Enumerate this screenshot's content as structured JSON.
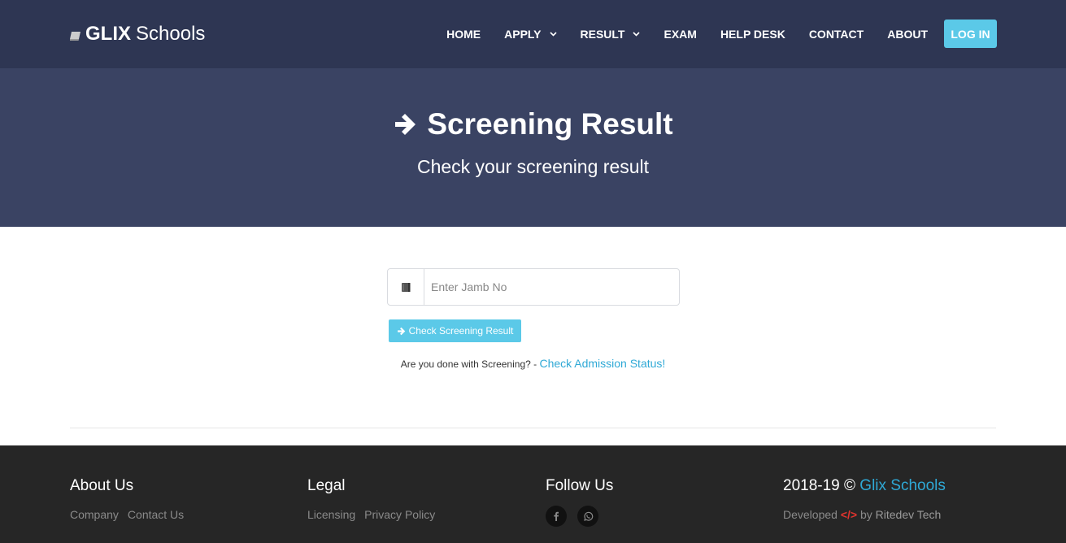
{
  "brand": {
    "bold": "GLIX",
    "light": "Schools",
    "icon": "book-icon"
  },
  "nav": {
    "items": [
      {
        "label": "HOME",
        "dropdown": false
      },
      {
        "label": "APPLY",
        "dropdown": true
      },
      {
        "label": "RESULT",
        "dropdown": true
      },
      {
        "label": "EXAM",
        "dropdown": false
      },
      {
        "label": "HELP DESK",
        "dropdown": false
      },
      {
        "label": "CONTACT",
        "dropdown": false
      },
      {
        "label": "ABOUT",
        "dropdown": false
      }
    ],
    "login_label": "LOG IN"
  },
  "hero": {
    "title": "Screening Result",
    "subtitle": "Check your screening result",
    "icon": "arrow-right-icon"
  },
  "form": {
    "placeholder": "Enter Jamb No",
    "value": "",
    "button_label": "Check Screening Result",
    "done_text": "Are you done with Screening? - ",
    "done_link": "Check Admission Status!"
  },
  "footer": {
    "about": {
      "title": "About Us",
      "links": [
        "Company",
        "Contact Us"
      ]
    },
    "legal": {
      "title": "Legal",
      "links": [
        "Licensing",
        "Privacy Policy"
      ]
    },
    "follow": {
      "title": "Follow Us",
      "icons": [
        "facebook-icon",
        "whatsapp-icon"
      ]
    },
    "copyright": {
      "years": "2018-19 ©",
      "name": "Glix Schools",
      "developed": "Developed",
      "code_symbol": "</>",
      "by": "by",
      "developer": "Ritedev Tech"
    }
  },
  "colors": {
    "navbar": "#2e3653",
    "hero": "#3a4363",
    "accent": "#5bc9e8",
    "link": "#2fa9d6",
    "footer": "#262626",
    "code": "#e0342e"
  }
}
